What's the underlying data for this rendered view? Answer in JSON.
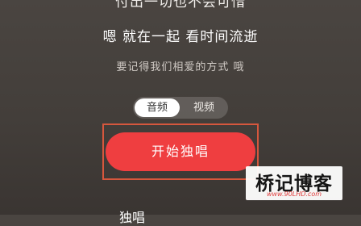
{
  "lyrics": {
    "previous": "付出一切也不会可惜",
    "current": "嗯 就在一起 看时间流逝",
    "next": "要记得我们相爱的方式 哦"
  },
  "mode_toggle": {
    "options": [
      "音频",
      "视频"
    ],
    "selected": "音频"
  },
  "actions": {
    "solo_label": "开始独唱"
  },
  "bottom_bar": {
    "left": "",
    "center": "独唱",
    "right": ""
  },
  "watermark": {
    "name": "桥记博客",
    "url": "www.90LHD.com"
  },
  "colors": {
    "background": "#45403c",
    "accent": "#ef3e40",
    "highlight_border": "#d6573d"
  }
}
